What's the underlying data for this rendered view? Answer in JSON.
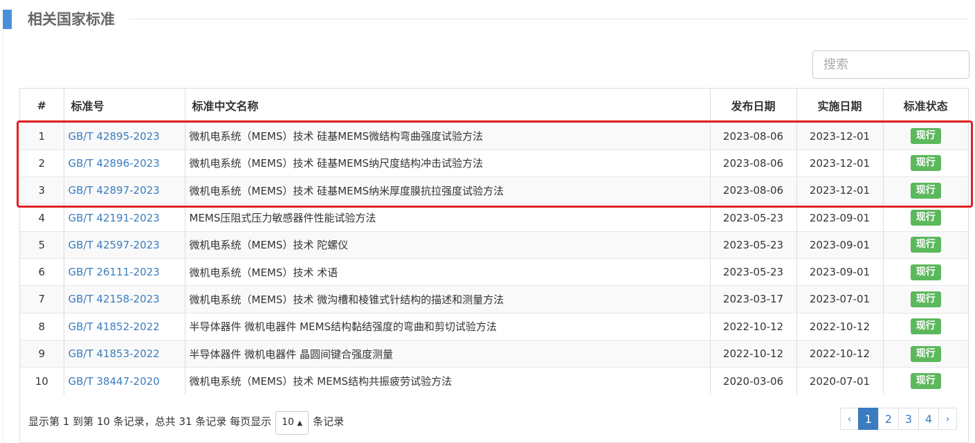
{
  "section_title": "相关国家标准",
  "search_placeholder": "搜索",
  "table": {
    "headers": [
      "#",
      "标准号",
      "标准中文名称",
      "发布日期",
      "实施日期",
      "标准状态"
    ],
    "rows": [
      {
        "idx": "1",
        "code": "GB/T 42895-2023",
        "name": "微机电系统（MEMS）技术 硅基MEMS微结构弯曲强度试验方法",
        "publish": "2023-08-06",
        "effective": "2023-12-01",
        "status": "现行"
      },
      {
        "idx": "2",
        "code": "GB/T 42896-2023",
        "name": "微机电系统（MEMS）技术 硅基MEMS纳尺度结构冲击试验方法",
        "publish": "2023-08-06",
        "effective": "2023-12-01",
        "status": "现行"
      },
      {
        "idx": "3",
        "code": "GB/T 42897-2023",
        "name": "微机电系统（MEMS）技术 硅基MEMS纳米厚度膜抗拉强度试验方法",
        "publish": "2023-08-06",
        "effective": "2023-12-01",
        "status": "现行"
      },
      {
        "idx": "4",
        "code": "GB/T 42191-2023",
        "name": "MEMS压阻式压力敏感器件性能试验方法",
        "publish": "2023-05-23",
        "effective": "2023-09-01",
        "status": "现行"
      },
      {
        "idx": "5",
        "code": "GB/T 42597-2023",
        "name": "微机电系统（MEMS）技术 陀螺仪",
        "publish": "2023-05-23",
        "effective": "2023-09-01",
        "status": "现行"
      },
      {
        "idx": "6",
        "code": "GB/T 26111-2023",
        "name": "微机电系统（MEMS）技术 术语",
        "publish": "2023-05-23",
        "effective": "2023-09-01",
        "status": "现行"
      },
      {
        "idx": "7",
        "code": "GB/T 42158-2023",
        "name": "微机电系统（MEMS）技术 微沟槽和棱锥式针结构的描述和测量方法",
        "publish": "2023-03-17",
        "effective": "2023-07-01",
        "status": "现行"
      },
      {
        "idx": "8",
        "code": "GB/T 41852-2022",
        "name": "半导体器件 微机电器件 MEMS结构黏结强度的弯曲和剪切试验方法",
        "publish": "2022-10-12",
        "effective": "2022-10-12",
        "status": "现行"
      },
      {
        "idx": "9",
        "code": "GB/T 41853-2022",
        "name": "半导体器件 微机电器件 晶圆间键合强度测量",
        "publish": "2022-10-12",
        "effective": "2022-10-12",
        "status": "现行"
      },
      {
        "idx": "10",
        "code": "GB/T 38447-2020",
        "name": "微机电系统（MEMS）技术 MEMS结构共振疲劳试验方法",
        "publish": "2020-03-06",
        "effective": "2020-07-01",
        "status": "现行"
      }
    ]
  },
  "footer": {
    "info_prefix": "显示第 1 到第 10 条记录，总共 31 条记录 每页显示",
    "page_size": "10",
    "page_size_arrow": "▲",
    "info_suffix": "条记录"
  },
  "pagination": {
    "prev": "‹",
    "pages": [
      "1",
      "2",
      "3",
      "4"
    ],
    "active_page": "1",
    "next": "›"
  },
  "colors": {
    "accent_bar": "#4a90d9",
    "link": "#3a7cbf",
    "status_badge": "#5cb85c",
    "highlight_border": "#e02020"
  }
}
